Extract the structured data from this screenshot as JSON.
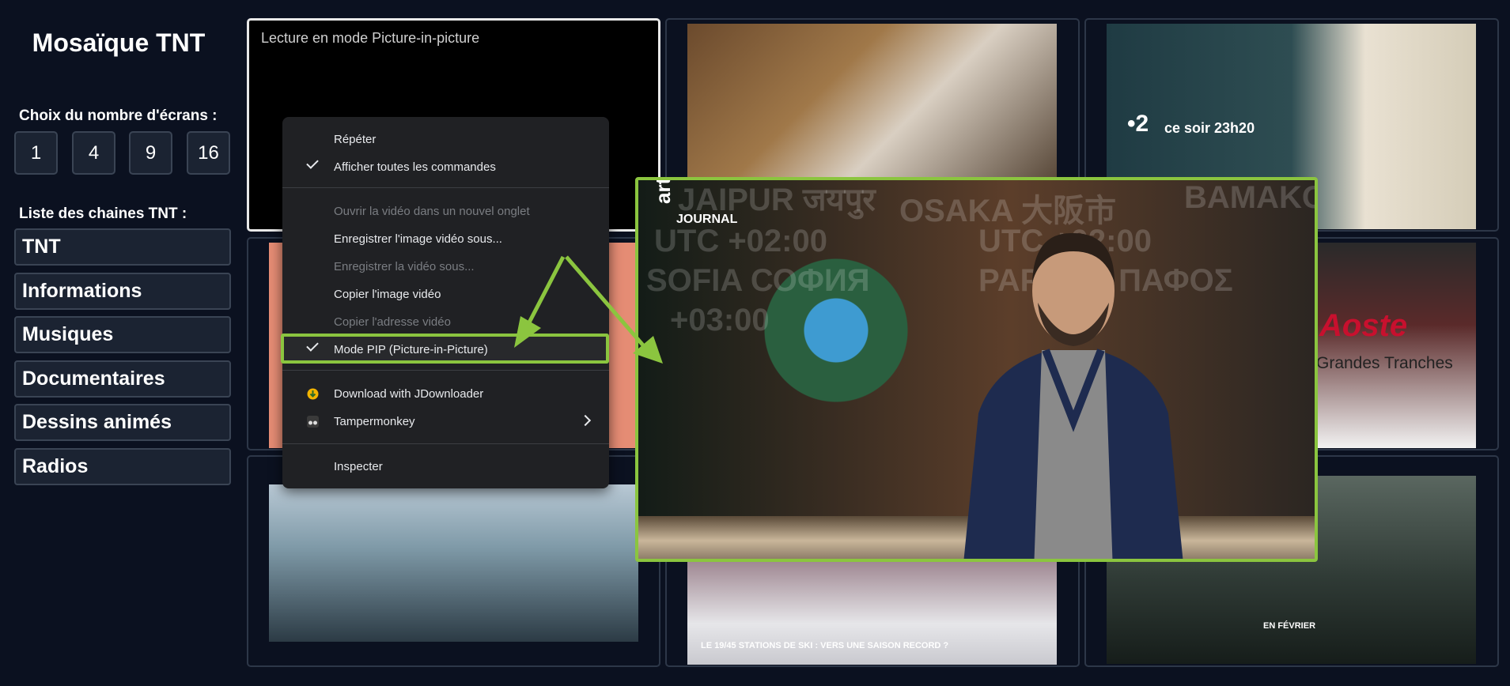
{
  "sidebar": {
    "title": "Mosaïque TNT",
    "count_label": "Choix du nombre d'écrans :",
    "counts": [
      "1",
      "4",
      "9",
      "16"
    ],
    "channels_label": "Liste des chaines TNT :",
    "categories": [
      "TNT",
      "Informations",
      "Musiques",
      "Documentaires",
      "Dessins animés",
      "Radios"
    ]
  },
  "tiles": {
    "active_caption": "Lecture en mode Picture-in-picture",
    "france2_logo": "•2",
    "france2_text": "ce soir 23h20",
    "ham_brand": "Aoste",
    "ham_sub": "Grandes Tranches",
    "ski_caption": "LE 19/45   STATIONS DE SKI : VERS UNE SAISON RECORD ?",
    "nrj_caption": "EN FÉVRIER"
  },
  "pip": {
    "channel_logo": "arte",
    "program": "JOURNAL",
    "cities": [
      "JAIPUR जयपुर",
      "OSAKA 大阪市",
      "BAMAKO",
      "UTC +02:00",
      "UTC +02:00",
      "SOFIA СОФИЯ",
      "PAPHOS ΠΑΦΟΣ",
      "+03:00"
    ]
  },
  "context_menu": {
    "items": [
      {
        "label": "Répéter",
        "checked": false,
        "disabled": false
      },
      {
        "label": "Afficher toutes les commandes",
        "checked": true,
        "disabled": false
      },
      {
        "label": "Ouvrir la vidéo dans un nouvel onglet",
        "checked": false,
        "disabled": true
      },
      {
        "label": "Enregistrer l'image vidéo sous...",
        "checked": false,
        "disabled": false
      },
      {
        "label": "Enregistrer la vidéo sous...",
        "checked": false,
        "disabled": true
      },
      {
        "label": "Copier l'image vidéo",
        "checked": false,
        "disabled": false
      },
      {
        "label": "Copier l'adresse vidéo",
        "checked": false,
        "disabled": true
      },
      {
        "label": "Mode PIP (Picture-in-Picture)",
        "checked": true,
        "disabled": false
      },
      {
        "label": "Download with JDownloader",
        "checked": false,
        "disabled": false,
        "icon": "jdownloader-icon"
      },
      {
        "label": "Tampermonkey",
        "checked": false,
        "disabled": false,
        "icon": "tampermonkey-icon",
        "submenu": true
      },
      {
        "label": "Inspecter",
        "checked": false,
        "disabled": false
      }
    ]
  },
  "colors": {
    "background": "#0b1120",
    "button": "#1b2332",
    "accent_green": "#8bc53f",
    "menu_bg": "#202124"
  }
}
